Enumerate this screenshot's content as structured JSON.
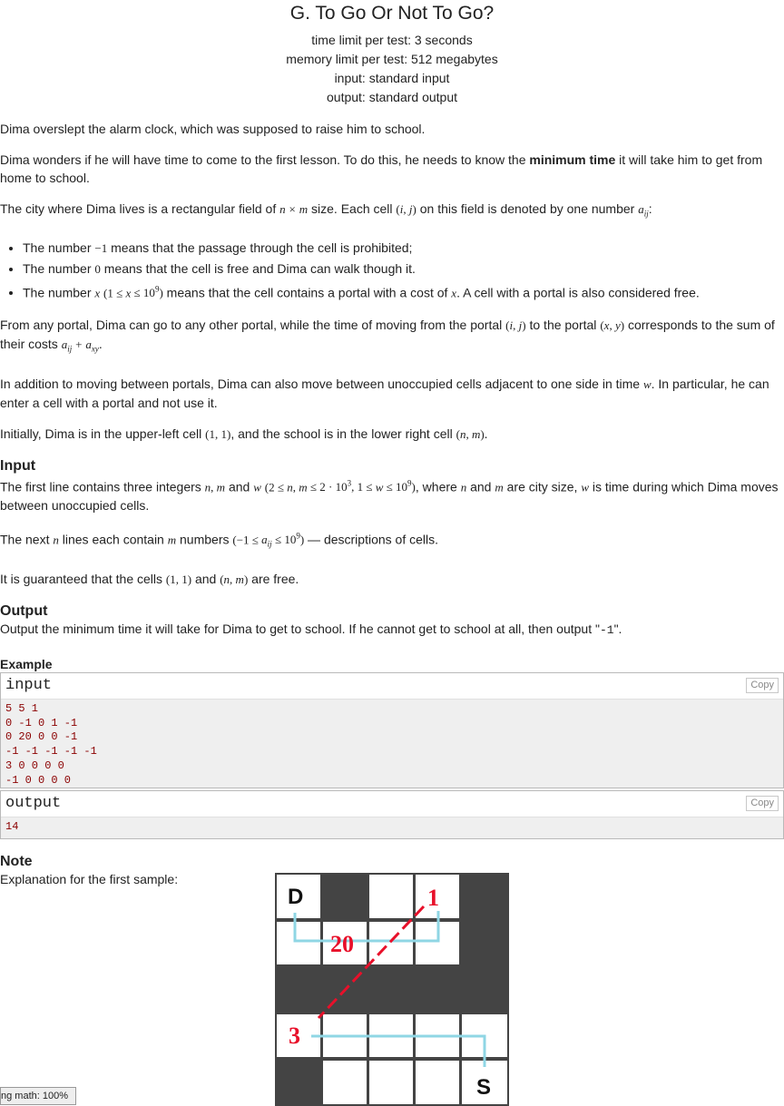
{
  "header": {
    "title": "G. To Go Or Not To Go?",
    "time_limit": "time limit per test: 3 seconds",
    "memory_limit": "memory limit per test: 512 megabytes",
    "input": "input: standard input",
    "output": "output: standard output"
  },
  "statement": {
    "p1": "Dima overslept the alarm clock, which was supposed to raise him to school.",
    "p2_a": "Dima wonders if he will have time to come to the first lesson. To do this, he needs to know the ",
    "p2_bold": "minimum time",
    "p2_b": " it will take him to get from home to school.",
    "p3_a": "The city where Dima lives is a rectangular field of ",
    "p3_b": " size. Each cell ",
    "p3_c": " on this field is denoted by one number ",
    "bullet1_a": "The number ",
    "bullet1_b": " means that the passage through the cell is prohibited;",
    "bullet2_a": "The number ",
    "bullet2_b": " means that the cell is free and Dima can walk though it.",
    "bullet3_a": "The number ",
    "bullet3_b": " means that the cell contains a portal with a cost of ",
    "bullet3_c": ". A cell with a portal is also considered free.",
    "p4_a": "From any portal, Dima can go to any other portal, while the time of moving from the portal ",
    "p4_b": " to the portal ",
    "p4_c": " corresponds to the sum of their costs ",
    "p5_a": "In addition to moving between portals, Dima can also move between unoccupied cells adjacent to one side in time ",
    "p5_b": ". In particular, he can enter a cell with a portal and not use it.",
    "p6_a": "Initially, Dima is in the upper-left cell ",
    "p6_b": ", and the school is in the lower right cell "
  },
  "input_section": {
    "title": "Input",
    "p1_a": "The first line contains three integers ",
    "p1_b": " and ",
    "p1_c": ", where ",
    "p1_d": " and ",
    "p1_e": " are city size, ",
    "p1_f": " is time during which Dima moves between unoccupied cells.",
    "p2_a": "The next ",
    "p2_b": " lines each contain ",
    "p2_c": " numbers ",
    "p2_d": " — descriptions of cells.",
    "p3_a": "It is guaranteed that the cells ",
    "p3_b": " and ",
    "p3_c": " are free."
  },
  "output_section": {
    "title": "Output",
    "p1_a": "Output the minimum time it will take for Dima to get to school. If he cannot get to school at all, then output \"",
    "p1_code": "-1",
    "p1_b": "\"."
  },
  "example": {
    "title": "Example",
    "input_label": "input",
    "input_text": "5 5 1\n0 -1 0 1 -1\n0 20 0 0 -1\n-1 -1 -1 -1 -1\n3 0 0 0 0\n-1 0 0 0 0",
    "output_label": "output",
    "output_text": "14",
    "copy_label": "Copy"
  },
  "note": {
    "title": "Note",
    "text": "Explanation for the first sample:",
    "grid_labels": {
      "start": "D",
      "school": "S",
      "portal_1": "1",
      "portal_20": "20",
      "portal_3": "3"
    },
    "colors": {
      "blocked": "#444444",
      "free": "#ffffff",
      "portal_path": "#e8102a",
      "walk_path": "#8fd6e4"
    }
  },
  "status": {
    "zoom_text": "ng math: 100%"
  }
}
